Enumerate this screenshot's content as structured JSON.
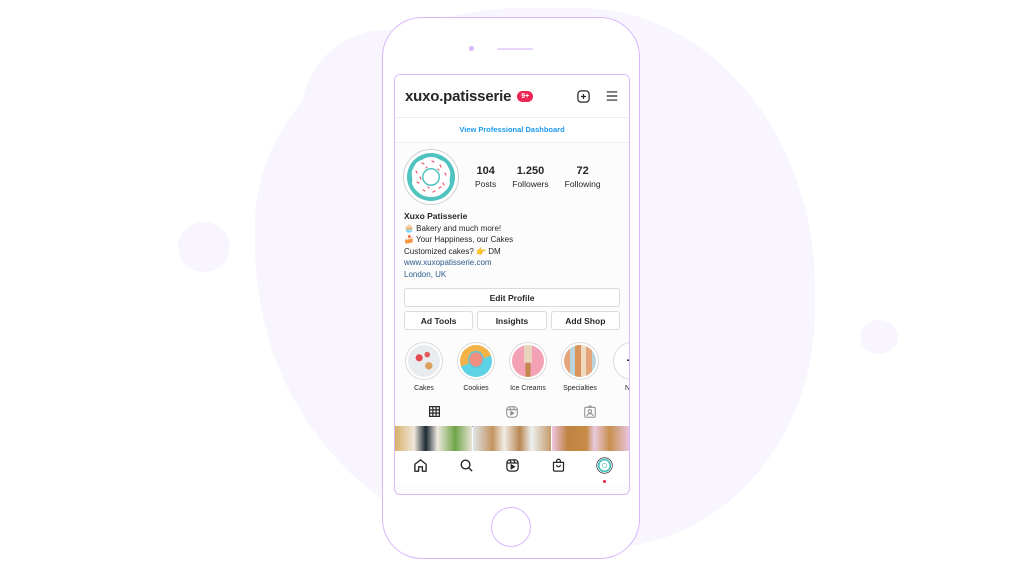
{
  "header": {
    "username": "xuxo.patisserie",
    "notification_badge": "9+",
    "new_post_icon": "plus-square-icon",
    "menu_icon": "hamburger-menu-icon"
  },
  "dashboard_link": "View Professional Dashboard",
  "profile": {
    "avatar_icon": "donut-avatar-icon",
    "stats": [
      {
        "value": "104",
        "label": "Posts"
      },
      {
        "value": "1.250",
        "label": "Followers"
      },
      {
        "value": "72",
        "label": "Following"
      }
    ],
    "bio": {
      "name": "Xuxo Patisserie",
      "lines": [
        "🧁 Bakery and much more!",
        "🍰 Your Happiness, our Cakes",
        "Customized cakes? 👉 DM"
      ],
      "website": "www.xuxopatisserie.com",
      "location": "London, UK"
    }
  },
  "actions": {
    "edit_profile": "Edit Profile",
    "ad_tools": "Ad Tools",
    "insights": "Insights",
    "add_shop": "Add Shop"
  },
  "highlights": [
    {
      "label": "Cakes"
    },
    {
      "label": "Cookies"
    },
    {
      "label": "Ice Creams"
    },
    {
      "label": "Specialties"
    },
    {
      "label": "New"
    }
  ],
  "tabs": [
    {
      "name": "posts-grid",
      "icon": "grid-icon",
      "active": true
    },
    {
      "name": "reels",
      "icon": "reels-icon",
      "active": false
    },
    {
      "name": "tagged",
      "icon": "tagged-user-icon",
      "active": false
    }
  ],
  "bottom_nav": [
    {
      "name": "home",
      "icon": "home-icon"
    },
    {
      "name": "search",
      "icon": "search-icon"
    },
    {
      "name": "reels",
      "icon": "reels-icon"
    },
    {
      "name": "shop",
      "icon": "shopping-bag-icon"
    },
    {
      "name": "profile",
      "icon": "profile-avatar-icon",
      "has_notification_dot": true
    }
  ],
  "colors": {
    "accent_link": "#1c9aef",
    "notification": "#ed2553",
    "frame": "#d9b8fb",
    "avatar_teal": "#4fc3c0"
  }
}
